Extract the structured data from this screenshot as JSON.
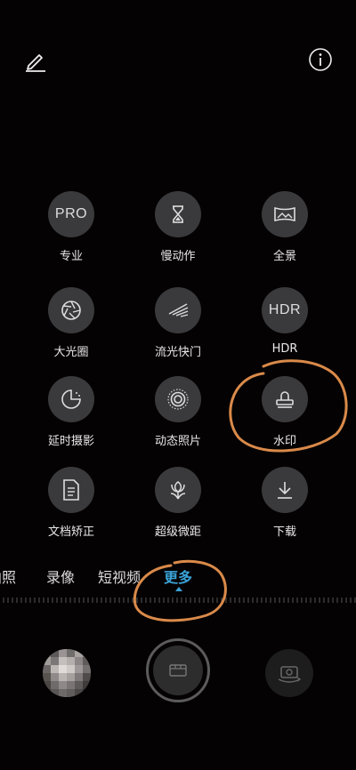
{
  "modes": [
    {
      "label": "专业",
      "icon": "pro-icon",
      "icon_text": "PRO"
    },
    {
      "label": "慢动作",
      "icon": "hourglass-icon"
    },
    {
      "label": "全景",
      "icon": "panorama-icon"
    },
    {
      "label": "大光圈",
      "icon": "aperture-icon"
    },
    {
      "label": "流光快门",
      "icon": "light-trails-icon"
    },
    {
      "label": "HDR",
      "icon": "hdr-icon",
      "icon_text": "HDR"
    },
    {
      "label": "延时摄影",
      "icon": "timelapse-icon"
    },
    {
      "label": "动态照片",
      "icon": "moving-picture-icon"
    },
    {
      "label": "水印",
      "icon": "stamp-icon"
    },
    {
      "label": "文档矫正",
      "icon": "document-icon"
    },
    {
      "label": "超级微距",
      "icon": "flower-macro-icon"
    },
    {
      "label": "下载",
      "icon": "download-icon"
    }
  ],
  "tabs": [
    {
      "label": "拍照"
    },
    {
      "label": "录像"
    },
    {
      "label": "短视频"
    },
    {
      "label": "更多",
      "active": true
    }
  ],
  "colors": {
    "accent": "#3aa3d8",
    "annotation": "#d98a4a",
    "circle_bg": "#3a3a3c"
  }
}
